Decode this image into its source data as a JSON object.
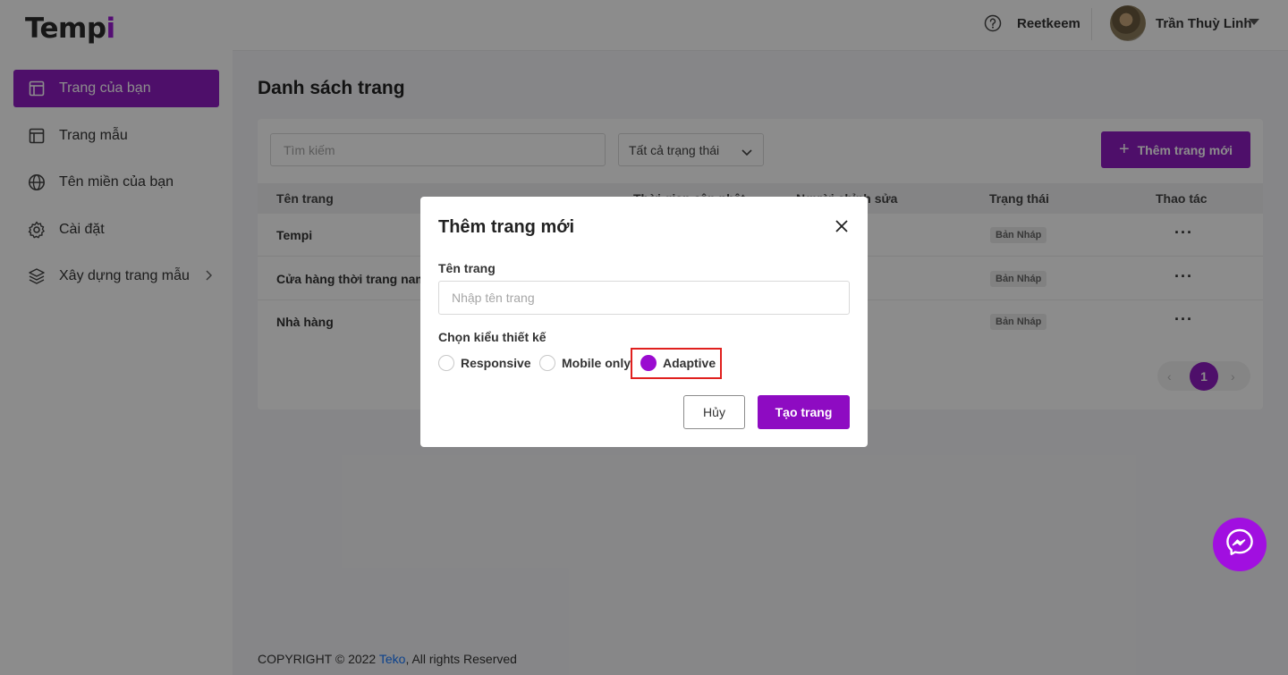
{
  "app": {
    "logo_main": "Temp",
    "logo_accent": "i"
  },
  "sidebar": {
    "items": [
      {
        "label": "Trang của bạn",
        "icon": "layout-icon",
        "active": true
      },
      {
        "label": "Trang mẫu",
        "icon": "layout-icon",
        "active": false
      },
      {
        "label": "Tên miền của bạn",
        "icon": "globe-icon",
        "active": false
      },
      {
        "label": "Cài đặt",
        "icon": "gear-icon",
        "active": false
      },
      {
        "label": "Xây dựng trang mẫu",
        "icon": "layers-icon",
        "active": false
      }
    ]
  },
  "header": {
    "workspace": "Reetkeem",
    "username": "Trần Thuỳ Linh"
  },
  "main": {
    "title": "Danh sách trang",
    "search_placeholder": "Tìm kiếm",
    "status_filter": "Tất cả trạng thái",
    "add_button": "Thêm trang mới",
    "table": {
      "columns": [
        "Tên trang",
        "Thời gian cập nhật",
        "Người chỉnh sửa",
        "Trạng thái",
        "Thao tác"
      ],
      "rows": [
        {
          "name": "Tempi",
          "status": "Bản Nháp"
        },
        {
          "name": "Cửa hàng thời trang nam",
          "status": "Bản Nháp"
        },
        {
          "name": "Nhà hàng",
          "status": "Bản Nháp"
        }
      ]
    },
    "pagination": {
      "current": "1",
      "prev": "‹",
      "next": "›"
    }
  },
  "footer": {
    "prefix": "COPYRIGHT © 2022 ",
    "link": "Teko",
    "suffix": ", All rights Reserved"
  },
  "modal": {
    "title": "Thêm trang mới",
    "name_label": "Tên trang",
    "name_placeholder": "Nhập tên trang",
    "design_label": "Chọn kiểu thiết kế",
    "options": [
      {
        "label": "Responsive",
        "selected": false
      },
      {
        "label": "Mobile only",
        "selected": false
      },
      {
        "label": "Adaptive",
        "selected": true
      }
    ],
    "cancel": "Hủy",
    "create": "Tạo trang"
  },
  "colors": {
    "primary": "#8e1cc1",
    "highlight": "#e0201e",
    "link": "#1677ff"
  }
}
